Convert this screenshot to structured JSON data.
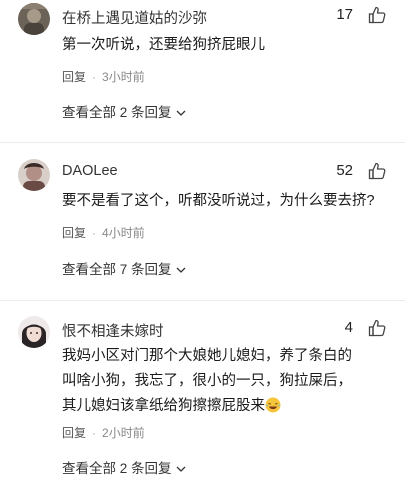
{
  "comments": [
    {
      "username": "在桥上遇见道姑的沙弥",
      "likes": "17",
      "text": "第一次听说，还要给狗挤屁眼儿",
      "reply_label": "回复",
      "time": "3小时前",
      "view_all": "查看全部 2 条回复"
    },
    {
      "username": "DAOLee",
      "likes": "52",
      "text": "要不是看了这个，听都没听说过，为什么要去挤?",
      "reply_label": "回复",
      "time": "4小时前",
      "view_all": "查看全部 7 条回复"
    },
    {
      "username": "恨不相逢未嫁时",
      "likes": "4",
      "text": "我妈小区对门那个大娘她儿媳妇，养了条白的叫啥小狗，我忘了，很小的一只，狗拉屎后，其儿媳妇该拿纸给狗擦擦屁股来",
      "reply_label": "回复",
      "time": "2小时前",
      "view_all": "查看全部 2 条回复"
    }
  ]
}
